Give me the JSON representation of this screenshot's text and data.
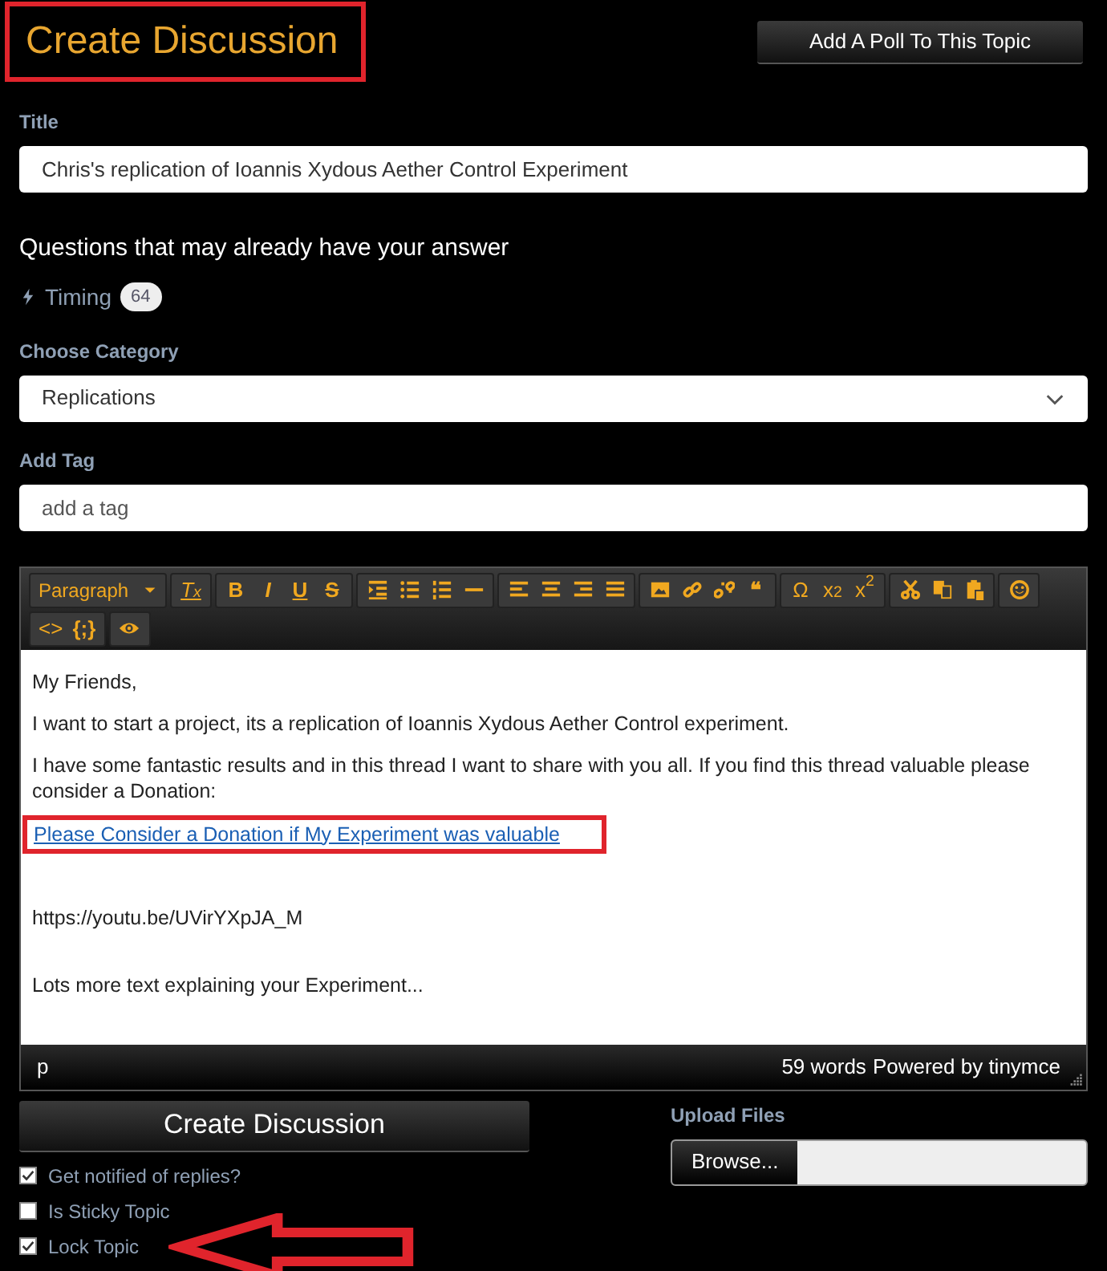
{
  "heading": {
    "text": "Create Discussion",
    "highlighted": true
  },
  "poll_button": "Add A Poll To This Topic",
  "title_field": {
    "label": "Title",
    "value": "Chris's replication of Ioannis Xydous Aether Control Experiment"
  },
  "suggestions": {
    "heading": "Questions that may already have your answer",
    "items": [
      {
        "label": "Timing",
        "count": "64"
      }
    ]
  },
  "category": {
    "label": "Choose Category",
    "value": "Replications"
  },
  "tag": {
    "label": "Add Tag",
    "placeholder": "add a tag"
  },
  "editor": {
    "toolbar_labels": [
      "Paragraph",
      "T$_{x}$",
      "B",
      "I",
      "U",
      "S",
      "❝",
      "Ω",
      "x$_{2}$",
      "x$^{2}$",
      "<>",
      "{;}"
    ],
    "content": [
      {
        "kind": "text",
        "text": "My Friends,"
      },
      {
        "kind": "text",
        "text": "I want to start a project, its a replication of Ioannis Xydous Aether Control experiment."
      },
      {
        "kind": "text",
        "text": "I have some fantastic results and in this thread I want to share with you all. If you find this thread valuable please consider a Donation:"
      },
      {
        "kind": "link",
        "text": "Please Consider a Donation if My Experiment was valuable",
        "highlighted": true
      },
      {
        "kind": "blank"
      },
      {
        "kind": "text",
        "text": "https://youtu.be/UVirYXpJA_M"
      },
      {
        "kind": "blank"
      },
      {
        "kind": "text",
        "text": "Lots more text explaining your Experiment..."
      }
    ],
    "path": "p",
    "word_count": "59 words",
    "powered_by": "Powered by tinymce"
  },
  "submit_button": "Create Discussion",
  "upload": {
    "label": "Upload Files",
    "button": "Browse..."
  },
  "options": [
    {
      "label": "Get notified of replies?",
      "checked": true,
      "annotated": false
    },
    {
      "label": "Is Sticky Topic",
      "checked": false,
      "annotated": false
    },
    {
      "label": "Lock Topic",
      "checked": true,
      "annotated": true
    }
  ]
}
